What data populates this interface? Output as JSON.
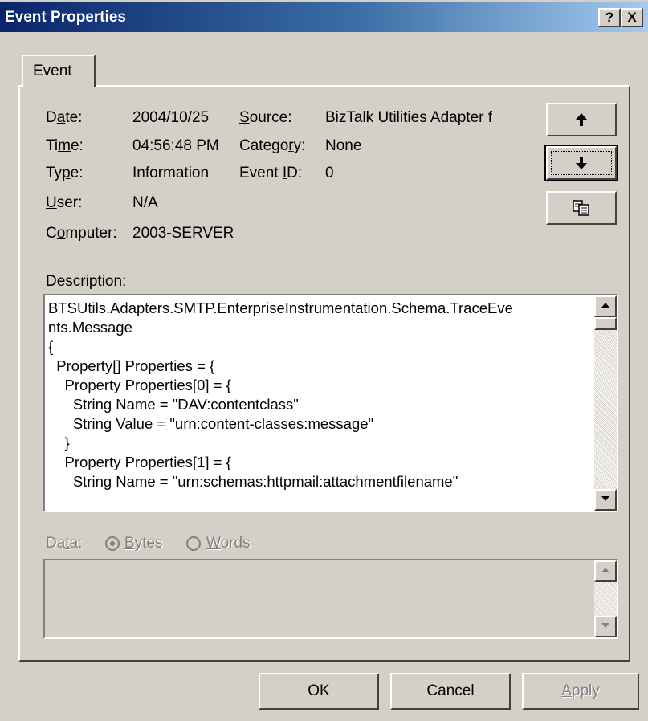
{
  "window": {
    "title": "Event Properties",
    "help_button": "?",
    "close_button": "X"
  },
  "tabs": [
    {
      "label": "Event"
    }
  ],
  "fields": {
    "date_label_pre": "D",
    "date_label_ul": "a",
    "date_label_post": "te:",
    "date_value": "2004/10/25",
    "time_label_pre": "Ti",
    "time_label_ul": "m",
    "time_label_post": "e:",
    "time_value": "04:56:48 PM",
    "type_label_pre": "Ty",
    "type_label_ul": "p",
    "type_label_post": "e:",
    "type_value": "Information",
    "user_label_pre": "",
    "user_label_ul": "U",
    "user_label_post": "ser:",
    "user_value": "N/A",
    "computer_label_pre": "C",
    "computer_label_ul": "o",
    "computer_label_post": "mputer:",
    "computer_value": "2003-SERVER",
    "source_label_pre": "",
    "source_label_ul": "S",
    "source_label_post": "ource:",
    "source_value": "BizTalk Utilities Adapter f",
    "category_label_pre": "Catego",
    "category_label_ul": "r",
    "category_label_post": "y:",
    "category_value": "None",
    "eventid_label_pre": "Event ",
    "eventid_label_ul": "I",
    "eventid_label_post": "D:",
    "eventid_value": "0"
  },
  "nav_buttons": {
    "up_icon": "arrow-up-icon",
    "down_icon": "arrow-down-icon",
    "copy_icon": "copy-icon"
  },
  "description": {
    "label_ul": "D",
    "label_post": "escription:",
    "text": "BTSUtils.Adapters.SMTP.EnterpriseInstrumentation.Schema.TraceEve\nnts.Message\n{\n  Property[] Properties = {\n    Property Properties[0] = {\n      String Name = \"DAV:contentclass\"\n      String Value = \"urn:content-classes:message\"\n    }\n    Property Properties[1] = {\n      String Name = \"urn:schemas:httpmail:attachmentfilename\""
  },
  "data_section": {
    "label_pre": "Da",
    "label_ul": "t",
    "label_post": "a:",
    "bytes_ul": "B",
    "bytes_post": "ytes",
    "words_ul": "W",
    "words_post": "ords",
    "selected": "Bytes"
  },
  "footer": {
    "ok": "OK",
    "cancel": "Cancel",
    "apply_ul": "A",
    "apply_post": "pply"
  },
  "colors": {
    "titlebar_start": "#0a246a",
    "titlebar_end": "#a6caf0",
    "face": "#d4d0c8"
  }
}
